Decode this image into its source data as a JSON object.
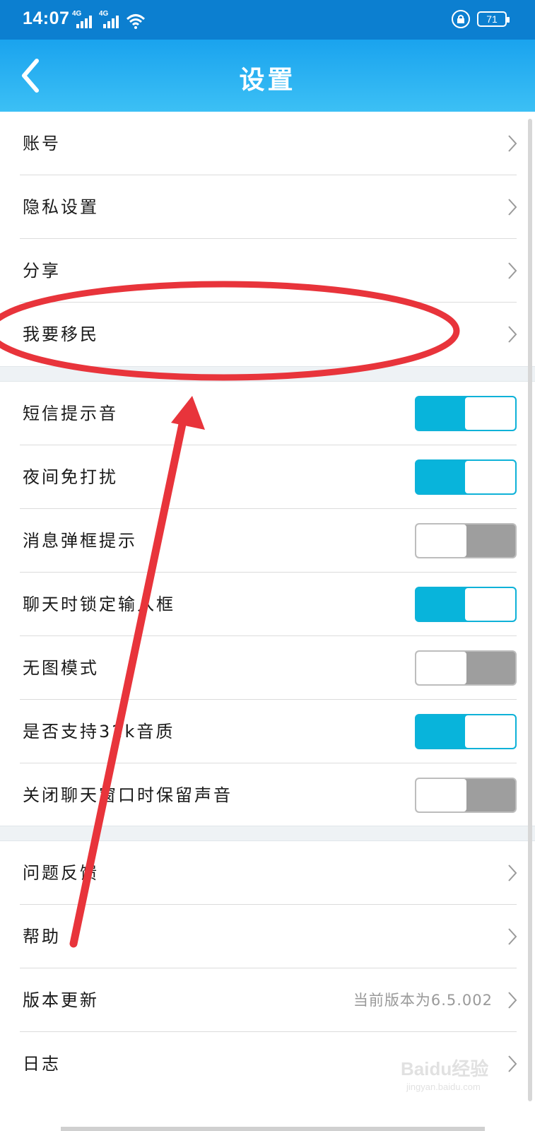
{
  "status_bar": {
    "time": "14:07",
    "signal1_label": "4G",
    "signal2_label": "4G",
    "battery": "71",
    "icons": [
      "signal-icon",
      "signal-icon",
      "wifi-icon",
      "rotation-lock-icon",
      "battery-icon"
    ]
  },
  "header": {
    "title": "设置",
    "back_icon": "back-chevron-icon"
  },
  "sections": {
    "account": [
      "账号",
      "隐私设置",
      "分享",
      "我要移民"
    ],
    "toggles": [
      {
        "label": "短信提示音",
        "on": true
      },
      {
        "label": "夜间免打扰",
        "on": true
      },
      {
        "label": "消息弹框提示",
        "on": false
      },
      {
        "label": "聊天时锁定输入框",
        "on": true
      },
      {
        "label": "无图模式",
        "on": false
      },
      {
        "label": "是否支持32k音质",
        "on": true
      },
      {
        "label": "关闭聊天窗口时保留声音",
        "on": false
      }
    ],
    "other": [
      {
        "label": "问题反馈",
        "value": ""
      },
      {
        "label": "帮助",
        "value": ""
      },
      {
        "label": "版本更新",
        "value": "当前版本为6.5.002"
      },
      {
        "label": "日志",
        "value": ""
      }
    ]
  },
  "watermark": {
    "main": "Baidu经验",
    "sub": "jingyan.baidu.com"
  },
  "colors": {
    "status_bar": "#0c7fd0",
    "header_top": "#1aa3ee",
    "header_bottom": "#3cc0f5",
    "toggle_on": "#08b4db",
    "toggle_off": "#9e9e9e",
    "annotation": "#e8343b"
  }
}
